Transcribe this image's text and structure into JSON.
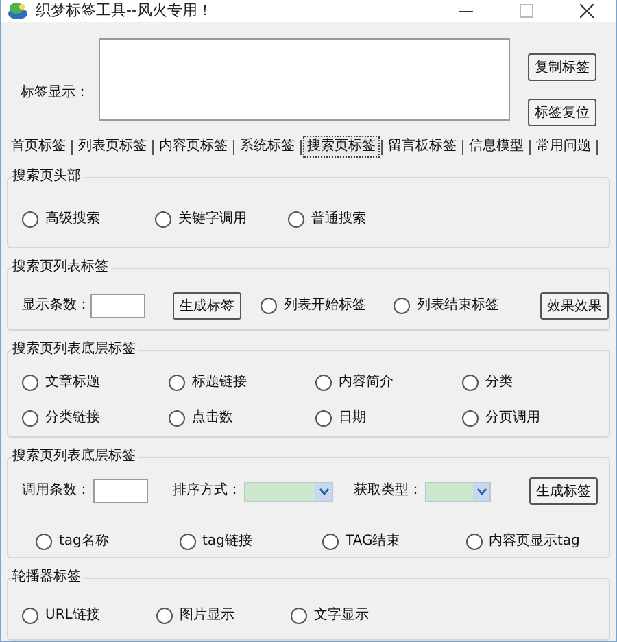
{
  "window": {
    "title": "织梦标签工具--风火专用！"
  },
  "display": {
    "label": "标签显示：",
    "buttons": [
      "复制标签",
      "标签复位"
    ]
  },
  "tabs": [
    {
      "label": "首页标签",
      "selected": false
    },
    {
      "label": "列表页标签",
      "selected": false
    },
    {
      "label": "内容页标签",
      "selected": false
    },
    {
      "label": "系统标签",
      "selected": false
    },
    {
      "label": "搜索页标签",
      "selected": true
    },
    {
      "label": "留言板标签",
      "selected": false
    },
    {
      "label": "信息模型",
      "selected": false
    },
    {
      "label": "常用问题",
      "selected": false
    }
  ],
  "groups": [
    {
      "title": "搜索页头部",
      "options": [
        [
          {
            "kind": "radio",
            "label": "高级搜索",
            "checked": false
          },
          {
            "kind": "radio",
            "label": "关键字调用",
            "checked": false
          },
          {
            "kind": "radio",
            "label": "普通搜索",
            "checked": false
          }
        ]
      ]
    },
    {
      "title": "搜索页列表标签",
      "fields": [
        {
          "kind": "label",
          "label": "显示条数："
        },
        {
          "kind": "input"
        },
        {
          "kind": "button",
          "label": "生成标签"
        },
        {
          "kind": "radio",
          "label": "列表开始标签",
          "checked": false
        },
        {
          "kind": "radio",
          "label": "列表结束标签",
          "checked": false
        },
        {
          "kind": "button",
          "label": "效果效果"
        }
      ]
    },
    {
      "title": "搜索页列表底层标签",
      "options": [
        [
          {
            "kind": "radio",
            "label": "文章标题",
            "checked": false
          },
          {
            "kind": "radio",
            "label": "标题链接",
            "checked": false
          },
          {
            "kind": "radio",
            "label": "内容简介",
            "checked": false
          },
          {
            "kind": "radio",
            "label": "分类",
            "checked": false
          }
        ],
        [
          {
            "kind": "radio",
            "label": "分类链接",
            "checked": false
          },
          {
            "kind": "radio",
            "label": "点击数",
            "checked": false
          },
          {
            "kind": "radio",
            "label": "日期",
            "checked": false
          },
          {
            "kind": "radio",
            "label": "分页调用",
            "checked": false
          }
        ]
      ]
    },
    {
      "title": "搜索页列表底层标签",
      "fields": [
        {
          "kind": "label",
          "label": "调用条数："
        },
        {
          "kind": "input"
        },
        {
          "kind": "label",
          "label": "排序方式："
        },
        {
          "kind": "select"
        },
        {
          "kind": "label",
          "label": "获取类型："
        },
        {
          "kind": "select"
        },
        {
          "kind": "button",
          "label": "生成标签"
        }
      ],
      "options": [
        [
          {
            "kind": "radio",
            "label": "tag名称",
            "checked": false
          },
          {
            "kind": "radio",
            "label": "tag链接",
            "checked": false
          },
          {
            "kind": "radio",
            "label": "TAG结束",
            "checked": false
          },
          {
            "kind": "radio",
            "label": "内容页显示tag",
            "checked": false
          }
        ]
      ]
    },
    {
      "title": "轮播器标签",
      "options": [
        [
          {
            "kind": "radio",
            "label": "URL链接",
            "checked": false
          },
          {
            "kind": "radio",
            "label": "图片显示",
            "checked": false
          },
          {
            "kind": "radio",
            "label": "文字显示",
            "checked": false
          }
        ]
      ]
    }
  ]
}
